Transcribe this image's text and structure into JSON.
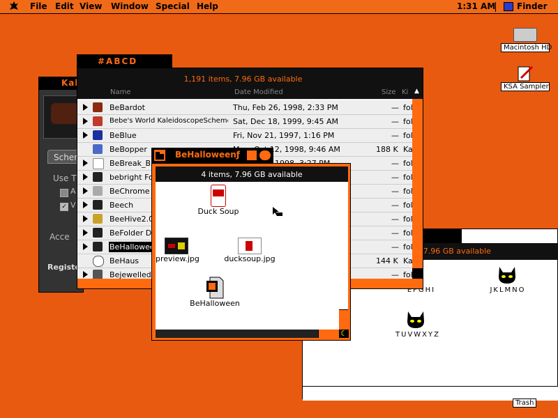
{
  "menubar": {
    "items": [
      "File",
      "Edit",
      "View",
      "Window",
      "Special",
      "Help"
    ],
    "time": "1:31 AM",
    "app": "Finder"
  },
  "desktop": {
    "hd_label": "Macintosh HD",
    "ksa_label": "KSA Sampler",
    "trash_label": "Trash"
  },
  "bg_window": {
    "title": "Kal",
    "scheme_tab": "Scher",
    "use_label": "Use T",
    "check_a": "A",
    "check_v": "V",
    "accent": "Acce",
    "register": "Registe"
  },
  "abcd_window": {
    "tab": "#ABCD",
    "status": "1,191 items, 7.96 GB available",
    "columns": {
      "name": "Name",
      "date": "Date Modified",
      "size": "Size",
      "kind": "Ki"
    },
    "rows": [
      {
        "name": "BeBardot",
        "date": "Thu, Feb 26, 1998, 2:33 PM",
        "size": "—",
        "kind": "fol"
      },
      {
        "name": "Bebe's World KaleidoscopeScheme",
        "date": "Sat, Dec 18, 1999, 9:45 AM",
        "size": "—",
        "kind": "fol"
      },
      {
        "name": "BeBlue",
        "date": "Fri, Nov 21, 1997, 1:16 PM",
        "size": "—",
        "kind": "fol"
      },
      {
        "name": "BeBopper",
        "date": "Mon, Oct 12, 1998, 9:46 AM",
        "size": "188 K",
        "kind": "Ka"
      },
      {
        "name": "BeBreak_Bl",
        "date": "1998, 3:27 PM",
        "size": "—",
        "kind": "fol"
      },
      {
        "name": "bebright Fol",
        "date": "",
        "size": "—",
        "kind": "fol"
      },
      {
        "name": "BeChrome ƒ",
        "date": "",
        "size": "—",
        "kind": "fol"
      },
      {
        "name": "Beech",
        "date": "",
        "size": "—",
        "kind": "fol"
      },
      {
        "name": "BeeHive2.0f",
        "date": "",
        "size": "—",
        "kind": "fol"
      },
      {
        "name": "BeFolder Des",
        "date": "",
        "size": "—",
        "kind": "fol"
      },
      {
        "name": "BeHalloween",
        "date": "",
        "size": "—",
        "kind": "fol"
      },
      {
        "name": "BeHaus",
        "date": "",
        "size": "144 K",
        "kind": "Ka"
      },
      {
        "name": "Bejewelled F",
        "date": "",
        "size": "—",
        "kind": "fol"
      }
    ]
  },
  "halloween_window": {
    "tab": "BeHalloweenƒ",
    "status": "4 items, 7.96 GB available",
    "files": [
      "Duck Soup",
      "preview.jpg",
      "ducksoup.jpg",
      "BeHalloween"
    ]
  },
  "right_window": {
    "tab_fragment": "s",
    "status": "s, 7.96 GB available",
    "labels": [
      "EFGHI",
      "JKLMNO",
      "TUVWXYZ"
    ]
  },
  "colors": {
    "accent": "#ff6a10",
    "desktop": "#e85a10"
  }
}
